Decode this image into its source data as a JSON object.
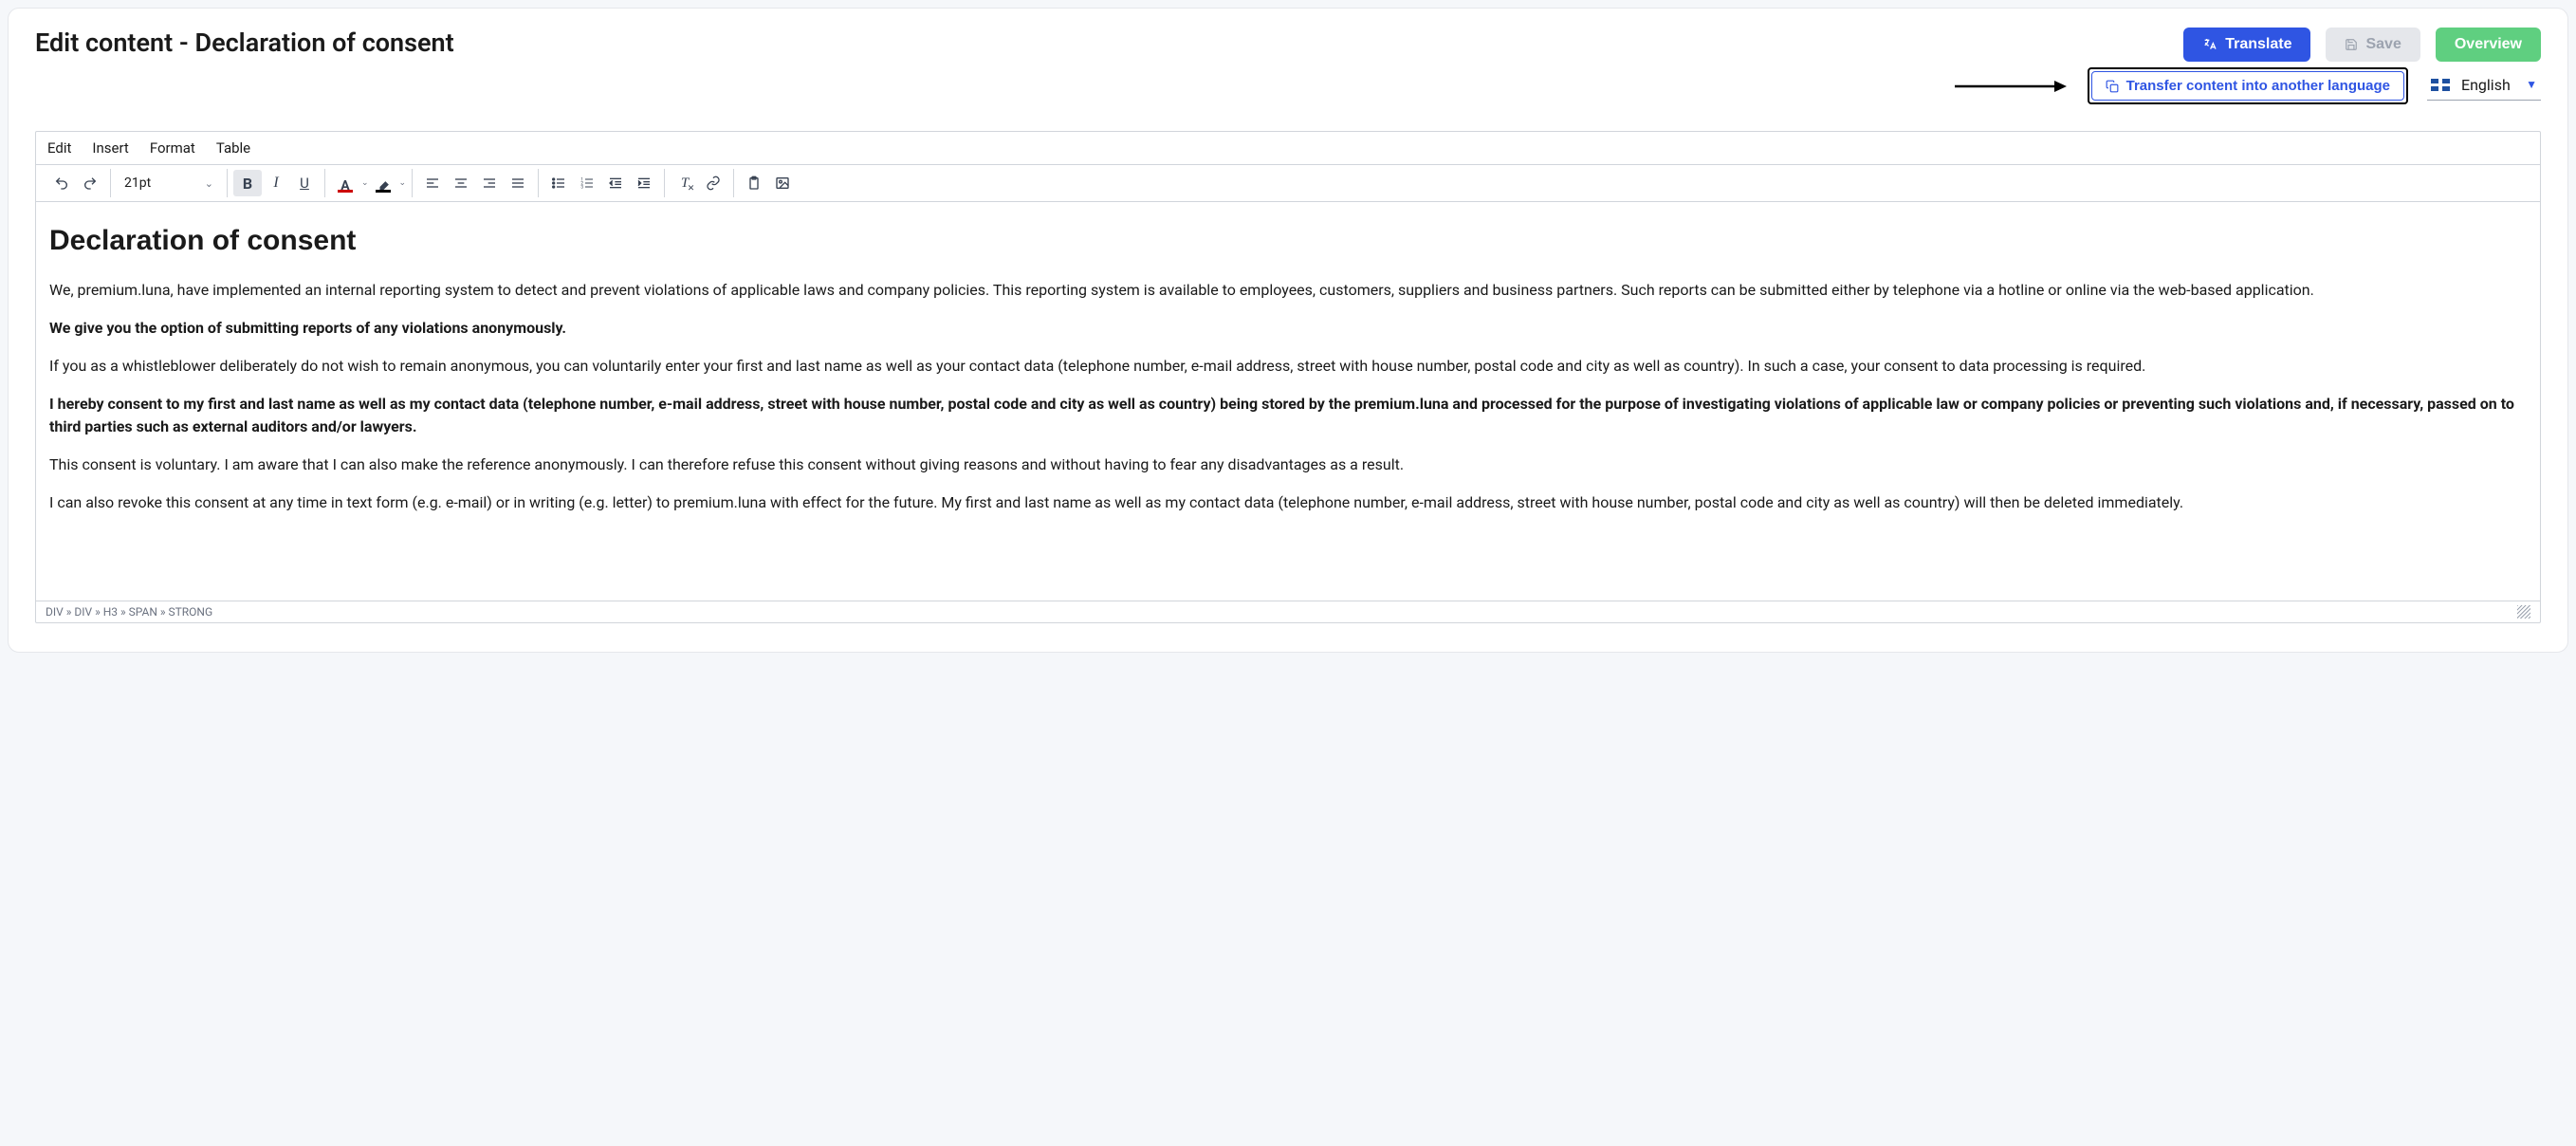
{
  "header": {
    "title": "Edit content - Declaration of consent",
    "translate_label": "Translate",
    "save_label": "Save",
    "overview_label": "Overview"
  },
  "subheader": {
    "transfer_label": "Transfer content into another language",
    "language": "English"
  },
  "editor": {
    "menus": [
      "Edit",
      "Insert",
      "Format",
      "Table"
    ],
    "font_size": "21pt",
    "body": {
      "heading": "Declaration of consent",
      "p1": "We, premium.luna, have implemented an internal reporting system to detect and prevent violations of applicable laws and company policies. This reporting system is available to employees, customers, suppliers and business partners. Such reports can be submitted either by telephone via a hotline or online via the web-based application.",
      "p2_bold": "We give you the option of submitting reports of any violations anonymously.",
      "p3": "If you as a whistleblower deliberately do not wish to remain anonymous, you can voluntarily enter your first and last name as well as your contact data (telephone number, e-mail address, street with house number, postal code and city as well as country). In such a case, your consent to data processing is required.",
      "p4_bold": "I hereby consent to my first and last name as well as my contact data (telephone number, e-mail address, street with house number, postal code and city as well as country) being stored by the premium.luna and processed for the purpose of investigating violations of applicable law or company policies or preventing such violations and, if necessary, passed on to third parties such as external auditors and/or lawyers.",
      "p5": "This consent is voluntary. I am aware that I can also make the reference anonymously. I can therefore refuse this consent without giving reasons and without having to fear any disadvantages as a result.",
      "p6": "I can also revoke this consent at any time in text form (e.g. e-mail) or in writing (e.g. letter) to premium.luna with effect for the future. My first and last name as well as my contact data (telephone number, e-mail address, street with house number, postal code and city as well as country) will then be deleted immediately."
    },
    "path": "DIV » DIV » H3 » SPAN » STRONG"
  }
}
